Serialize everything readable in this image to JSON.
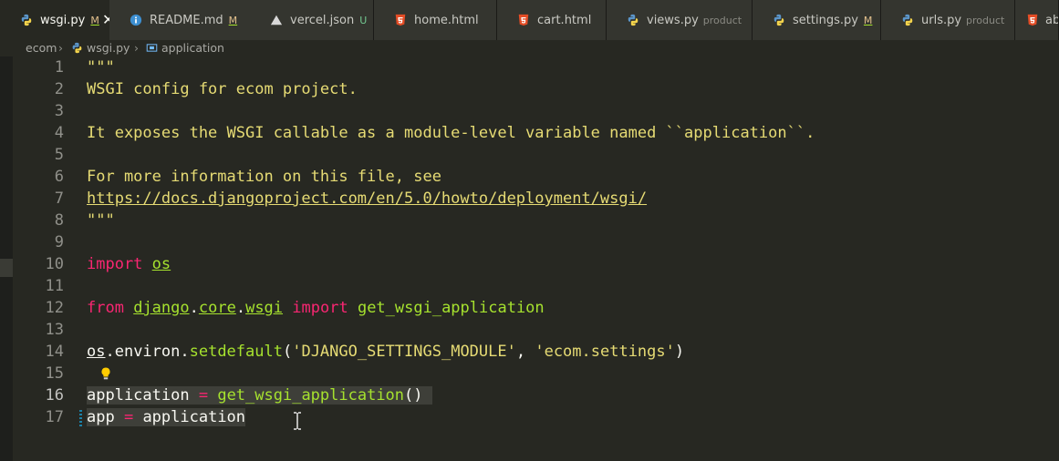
{
  "tabs": [
    {
      "label": "wsgi.py",
      "badge": "M",
      "badge_type": "mod",
      "icon": "python-file-icon",
      "active": true,
      "close": "✕"
    },
    {
      "label": "README.md",
      "badge": "M",
      "badge_type": "mod",
      "icon": "info-icon"
    },
    {
      "label": "vercel.json",
      "badge": "U",
      "badge_type": "unt",
      "icon": "vercel-icon"
    },
    {
      "label": "home.html",
      "icon": "html5-icon"
    },
    {
      "label": "cart.html",
      "icon": "html5-icon"
    },
    {
      "label": "views.py",
      "desc": "product",
      "icon": "python-file-icon"
    },
    {
      "label": "settings.py",
      "badge": "M",
      "badge_type": "mod",
      "icon": "python-file-icon"
    },
    {
      "label": "urls.py",
      "desc": "product",
      "icon": "python-file-icon"
    },
    {
      "label": "ab",
      "icon": "html5-icon"
    }
  ],
  "breadcrumb": {
    "items": [
      "ecom",
      "wsgi.py",
      "application"
    ],
    "separator": "›"
  },
  "editor": {
    "lines": [
      {
        "n": "1",
        "t": [
          {
            "x": "\"\"\"",
            "c": "doc"
          }
        ]
      },
      {
        "n": "2",
        "t": [
          {
            "x": "WSGI config for ecom project.",
            "c": "doc"
          }
        ]
      },
      {
        "n": "3",
        "t": []
      },
      {
        "n": "4",
        "t": [
          {
            "x": "It exposes the WSGI callable as a module-level variable named ``application``.",
            "c": "doc"
          }
        ]
      },
      {
        "n": "5",
        "t": []
      },
      {
        "n": "6",
        "t": [
          {
            "x": "For more information on this file, see",
            "c": "doc"
          }
        ]
      },
      {
        "n": "7",
        "t": [
          {
            "x": "https://docs.djangoproject.com/en/5.0/howto/deployment/wsgi/",
            "c": "doc url"
          }
        ]
      },
      {
        "n": "8",
        "t": [
          {
            "x": "\"\"\"",
            "c": "doc"
          }
        ]
      },
      {
        "n": "9",
        "t": []
      },
      {
        "n": "10",
        "t": [
          {
            "x": "import",
            "c": "kw"
          },
          {
            "x": " "
          },
          {
            "x": "os",
            "c": "mod"
          }
        ]
      },
      {
        "n": "11",
        "t": []
      },
      {
        "n": "12",
        "t": [
          {
            "x": "from",
            "c": "kw"
          },
          {
            "x": " "
          },
          {
            "x": "django",
            "c": "mod"
          },
          {
            "x": "."
          },
          {
            "x": "core",
            "c": "mod"
          },
          {
            "x": "."
          },
          {
            "x": "wsgi",
            "c": "mod"
          },
          {
            "x": " "
          },
          {
            "x": "import",
            "c": "kw"
          },
          {
            "x": " "
          },
          {
            "x": "get_wsgi_application",
            "c": "fn"
          }
        ]
      },
      {
        "n": "13",
        "t": []
      },
      {
        "n": "14",
        "t": [
          {
            "x": "os",
            "c": "und"
          },
          {
            "x": ".environ."
          },
          {
            "x": "setdefault",
            "c": "fn"
          },
          {
            "x": "("
          },
          {
            "x": "'DJANGO_SETTINGS_MODULE'",
            "c": "str"
          },
          {
            "x": ", "
          },
          {
            "x": "'ecom.settings'",
            "c": "str"
          },
          {
            "x": ")"
          }
        ]
      },
      {
        "n": "15",
        "t": [],
        "bulb": true
      },
      {
        "n": "16",
        "t": [
          {
            "x": "application ",
            "c": "sel"
          },
          {
            "x": "=",
            "c": "kw sel"
          },
          {
            "x": " ",
            "c": "sel"
          },
          {
            "x": "get_wsgi_application",
            "c": "fn sel"
          },
          {
            "x": "() ",
            "c": "sel"
          }
        ],
        "current": true
      },
      {
        "n": "17",
        "t": [
          {
            "x": "app ",
            "c": "sel"
          },
          {
            "x": "=",
            "c": "kw sel"
          },
          {
            "x": " application",
            "c": "sel"
          }
        ],
        "gutter_mark": true
      }
    ]
  },
  "colors": {
    "background": "#272822",
    "keyword": "#f92672",
    "string": "#e6db74",
    "function": "#a6e22e",
    "modified": "#e2c08d",
    "untracked": "#73c991"
  }
}
